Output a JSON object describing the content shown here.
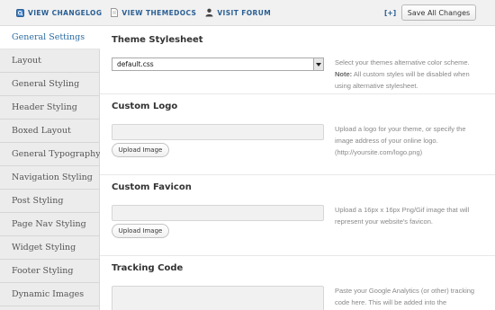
{
  "toolbar": {
    "links": [
      {
        "label": "View Changelog",
        "icon": "changelog-icon"
      },
      {
        "label": "View Themedocs",
        "icon": "document-icon"
      },
      {
        "label": "Visit Forum",
        "icon": "person-icon"
      }
    ],
    "expand_label": "[+]",
    "save_label": "Save All Changes"
  },
  "sidebar": {
    "items": [
      {
        "label": "General Settings",
        "active": true
      },
      {
        "label": "Layout"
      },
      {
        "label": "General Styling"
      },
      {
        "label": "Header Styling"
      },
      {
        "label": "Boxed Layout"
      },
      {
        "label": "General Typography"
      },
      {
        "label": "Navigation Styling"
      },
      {
        "label": "Post Styling"
      },
      {
        "label": "Page Nav Styling"
      },
      {
        "label": "Widget Styling"
      },
      {
        "label": "Footer Styling"
      },
      {
        "label": "Dynamic Images"
      }
    ]
  },
  "sections": {
    "stylesheet": {
      "title": "Theme Stylesheet",
      "select_value": "default.css",
      "desc_1": "Select your themes alternative color scheme.",
      "desc_note": "Note:",
      "desc_2": " All custom styles will be disabled when using alternative stylesheet."
    },
    "logo": {
      "title": "Custom Logo",
      "button": "Upload Image",
      "desc": "Upload a logo for your theme, or specify the image address of your online logo. (http://yoursite.com/logo.png)"
    },
    "favicon": {
      "title": "Custom Favicon",
      "button": "Upload Image",
      "desc": "Upload a 16px x 16px Png/Gif image that will represent your website's favicon."
    },
    "tracking": {
      "title": "Tracking Code",
      "desc": "Paste your Google Analytics (or other) tracking code here. This will be added into the"
    }
  },
  "colors": {
    "link": "#2a5f94",
    "active_nav": "#2b6ca3",
    "sidebar_bg": "#ececec"
  }
}
